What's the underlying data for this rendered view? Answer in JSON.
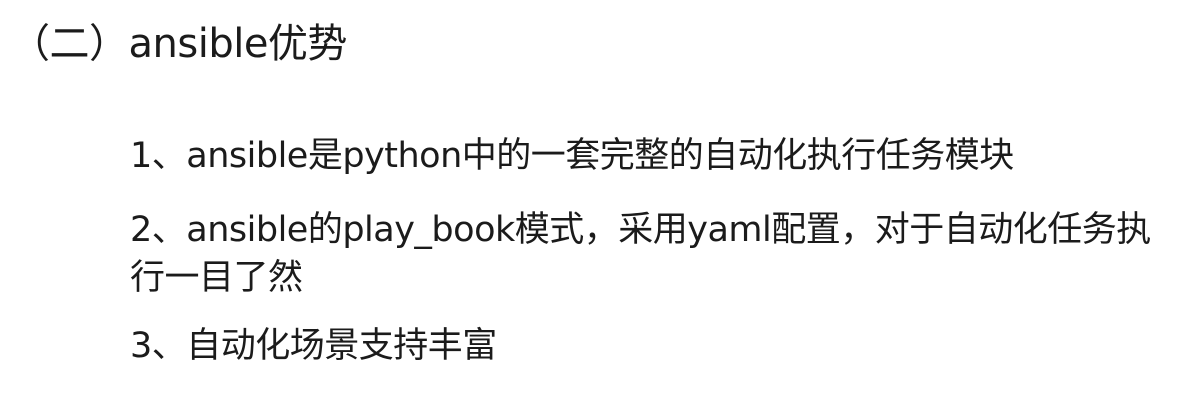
{
  "slide": {
    "heading": "（二）ansible优势",
    "points": [
      "1、ansible是python中的一套完整的自动化执行任务模块",
      "2、ansible的play_book模式，采用yaml配置，对于自动化任务执行一目了然",
      "3、自动化场景支持丰富"
    ]
  }
}
